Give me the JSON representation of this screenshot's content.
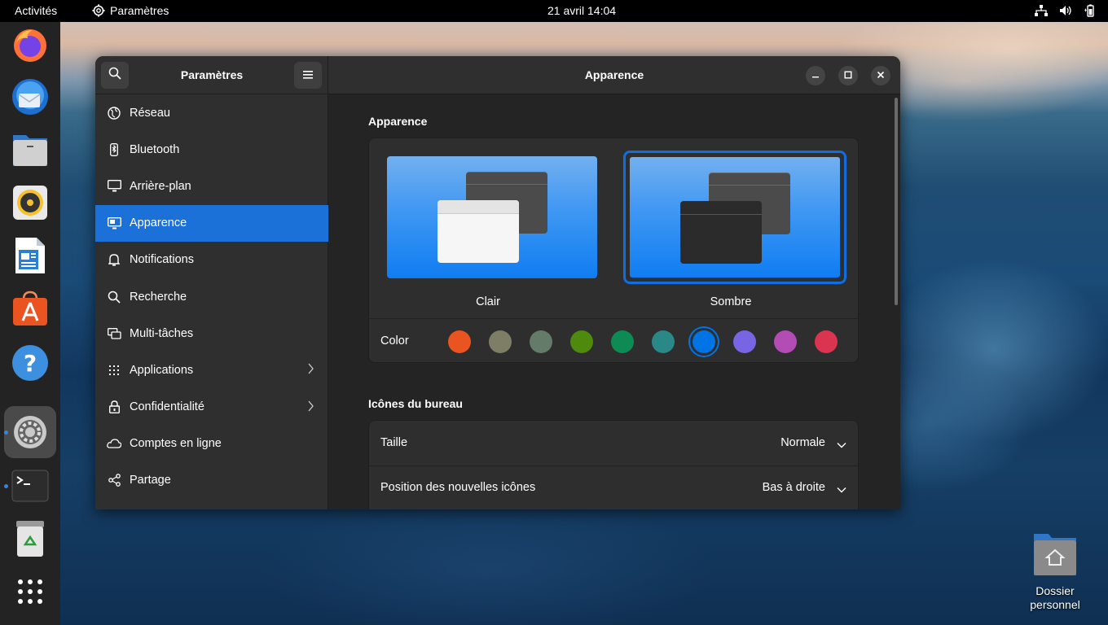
{
  "topbar": {
    "activities": "Activités",
    "app_name": "Paramètres",
    "clock": "21 avril  14:04",
    "tray_icons": [
      "network-icon",
      "volume-icon",
      "battery-icon"
    ]
  },
  "dock": {
    "apps": [
      "firefox-icon",
      "thunderbird-icon",
      "files-icon",
      "rhythmbox-icon",
      "libreoffice-writer-icon",
      "app-center-icon",
      "help-icon",
      "settings-icon",
      "terminal-icon",
      "trash-icon",
      "show-apps-icon"
    ],
    "active_app": "settings-icon"
  },
  "desktop": {
    "home_folder_label_1": "Dossier",
    "home_folder_label_2": "personnel"
  },
  "window": {
    "sidebar_title": "Paramètres",
    "title": "Apparence",
    "sidebar_items": [
      {
        "label": "Réseau",
        "icon": "network-globe-icon"
      },
      {
        "label": "Bluetooth",
        "icon": "bluetooth-icon"
      },
      {
        "label": "Arrière-plan",
        "icon": "display-icon"
      },
      {
        "label": "Apparence",
        "icon": "appearance-icon",
        "selected": true
      },
      {
        "label": "Notifications",
        "icon": "bell-icon"
      },
      {
        "label": "Recherche",
        "icon": "search-icon"
      },
      {
        "label": "Multi-tâches",
        "icon": "multitasking-icon"
      },
      {
        "label": "Applications",
        "icon": "apps-grid-icon",
        "chevron": true
      },
      {
        "label": "Confidentialité",
        "icon": "lock-icon",
        "chevron": true
      },
      {
        "label": "Comptes en ligne",
        "icon": "cloud-icon"
      },
      {
        "label": "Partage",
        "icon": "share-icon"
      }
    ]
  },
  "appearance": {
    "section_title": "Apparence",
    "themes": [
      {
        "label": "Clair",
        "selected": false
      },
      {
        "label": "Sombre",
        "selected": true
      }
    ],
    "color_label": "Color",
    "accent_colors": [
      "#e95420",
      "#7e7d66",
      "#657b69",
      "#4e8a0e",
      "#0e8a54",
      "#2a8986",
      "#0073e5",
      "#7765e3",
      "#b34cb3",
      "#da3450"
    ],
    "selected_accent": "#0073e5"
  },
  "desktop_icons": {
    "section_title": "Icônes du bureau",
    "rows": [
      {
        "label": "Taille",
        "value": "Normale"
      },
      {
        "label": "Position des nouvelles icônes",
        "value": "Bas à droite"
      }
    ]
  }
}
